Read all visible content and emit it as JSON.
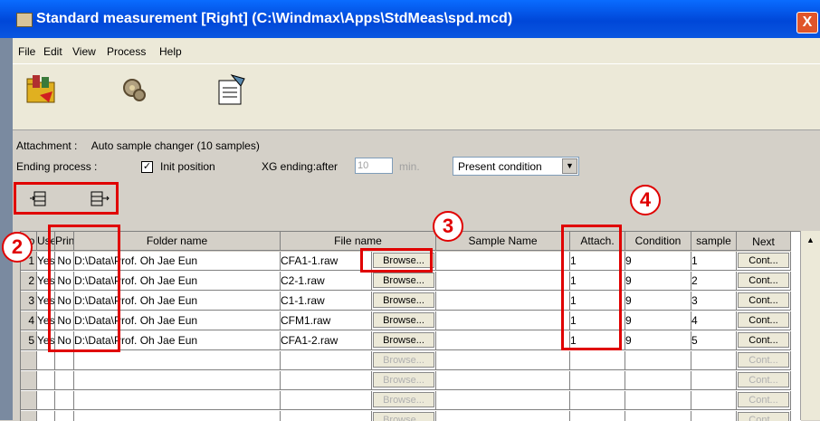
{
  "window": {
    "title": "Standard measurement [Right] (C:\\Windmax\\Apps\\StdMeas\\spd.mcd)",
    "close_label": "X"
  },
  "menu": {
    "items": [
      "File",
      "Edit",
      "View",
      "Process",
      "Help"
    ]
  },
  "toolbar": {
    "icons": [
      "open-folder-icon",
      "gear-icon",
      "report-icon"
    ]
  },
  "attachment": {
    "label": "Attachment :",
    "value": "Auto sample changer (10 samples)"
  },
  "ending": {
    "label": "Ending process :",
    "init_checked": true,
    "init_label": "Init position",
    "xg_label": "XG ending:after",
    "xg_value": "10",
    "min_label": "min.",
    "condition_value": "Present condition"
  },
  "callouts": [
    "2",
    "3",
    "4"
  ],
  "grid": {
    "headers": {
      "no": "No",
      "use": "Use",
      "print": "Print",
      "folder": "Folder name",
      "file": "File name",
      "sample": "Sample Name",
      "attach": "Attach.",
      "condition": "Condition",
      "samp": "sample",
      "next": "Next"
    },
    "browse_label": "Browse...",
    "cont_label": "Cont...",
    "rows": [
      {
        "no": "1",
        "use": "Yes",
        "print": "No",
        "folder": "D:\\Data\\Prof. Oh Jae Eun",
        "file": "CFA1-1.raw",
        "sample": "",
        "attach": "1",
        "condition": "9",
        "samp": "1"
      },
      {
        "no": "2",
        "use": "Yes",
        "print": "No",
        "folder": "D:\\Data\\Prof. Oh Jae Eun",
        "file": "C2-1.raw",
        "sample": "",
        "attach": "1",
        "condition": "9",
        "samp": "2"
      },
      {
        "no": "3",
        "use": "Yes",
        "print": "No",
        "folder": "D:\\Data\\Prof. Oh Jae Eun",
        "file": "C1-1.raw",
        "sample": "",
        "attach": "1",
        "condition": "9",
        "samp": "3"
      },
      {
        "no": "4",
        "use": "Yes",
        "print": "No",
        "folder": "D:\\Data\\Prof. Oh Jae Eun",
        "file": "CFM1.raw",
        "sample": "",
        "attach": "1",
        "condition": "9",
        "samp": "4"
      },
      {
        "no": "5",
        "use": "Yes",
        "print": "No",
        "folder": "D:\\Data\\Prof. Oh Jae Eun",
        "file": "CFA1-2.raw",
        "sample": "",
        "attach": "1",
        "condition": "9",
        "samp": "5"
      }
    ],
    "empty_rows": 4
  }
}
